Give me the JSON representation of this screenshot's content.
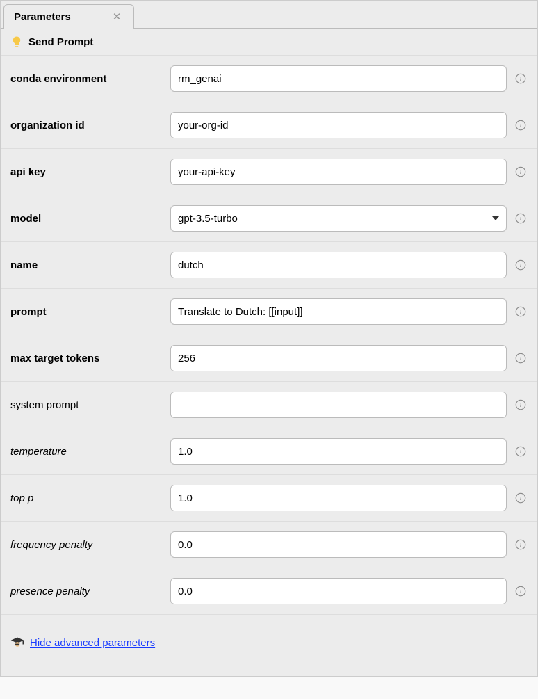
{
  "tab": {
    "label": "Parameters"
  },
  "header": {
    "title": "Send Prompt"
  },
  "fields": {
    "conda_env": {
      "label": "conda environment",
      "value": "rm_genai"
    },
    "org_id": {
      "label": "organization id",
      "value": "your-org-id"
    },
    "api_key": {
      "label": "api key",
      "value": "your-api-key"
    },
    "model": {
      "label": "model",
      "value": "gpt-3.5-turbo"
    },
    "name": {
      "label": "name",
      "value": "dutch"
    },
    "prompt": {
      "label": "prompt",
      "value": "Translate to Dutch: [[input]]"
    },
    "max_tokens": {
      "label": "max target tokens",
      "value": "256"
    },
    "system_prompt": {
      "label": "system prompt",
      "value": ""
    },
    "temperature": {
      "label": "temperature",
      "value": "1.0"
    },
    "top_p": {
      "label": "top p",
      "value": "1.0"
    },
    "freq_penalty": {
      "label": "frequency penalty",
      "value": "0.0"
    },
    "pres_penalty": {
      "label": "presence penalty",
      "value": "0.0"
    }
  },
  "footer": {
    "toggle_label": "Hide advanced parameters"
  }
}
